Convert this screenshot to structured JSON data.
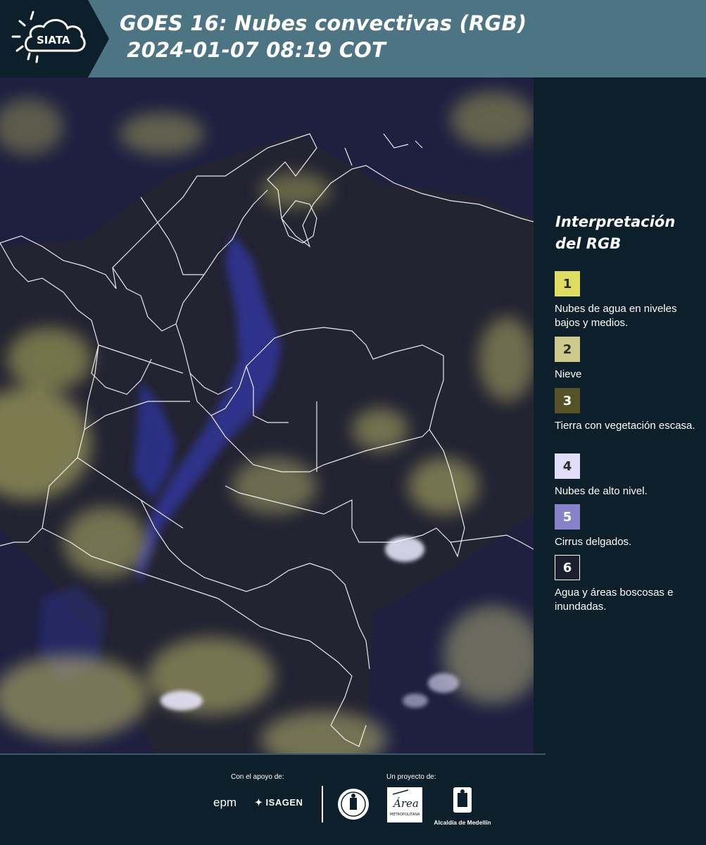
{
  "header": {
    "logo_text": "SIATA",
    "title_line1": "GOES 16: Nubes convectivas (RGB)",
    "title_line2": " 2024-01-07 08:19 COT"
  },
  "legend": {
    "title_line1": "Interpretación",
    "title_line2": "del RGB",
    "items": [
      {
        "number": "1",
        "color": "#dedd62",
        "label": "Nubes de agua en niveles bajos y medios."
      },
      {
        "number": "2",
        "color": "#cdc98a",
        "label": "Nieve"
      },
      {
        "number": "3",
        "color": "#545226",
        "label": "Tierra con vegetación escasa."
      },
      {
        "number": "4",
        "color": "#e1defa",
        "label": "Nubes de alto nivel."
      },
      {
        "number": "5",
        "color": "#8683c8",
        "label": "Cirrus delgados."
      },
      {
        "number": "6",
        "color": "#1b2031",
        "label": "Agua y áreas boscosas e inundadas."
      }
    ]
  },
  "footer": {
    "support_label": "Con el apoyo de:",
    "project_label": "Un proyecto de:",
    "sponsor_1": "epm",
    "sponsor_2": "ISAGEN",
    "area_text": "Área",
    "area_sub": "METROPOLITANA",
    "alcaldia": "Alcaldía de Medellín"
  },
  "colors": {
    "header_bg": "#4d7482",
    "panel_bg": "#0c1f2b",
    "map_ocean": "#1e2040",
    "cloud_yellow": "#c8c46a",
    "cloud_blue": "#3a3fa0"
  }
}
